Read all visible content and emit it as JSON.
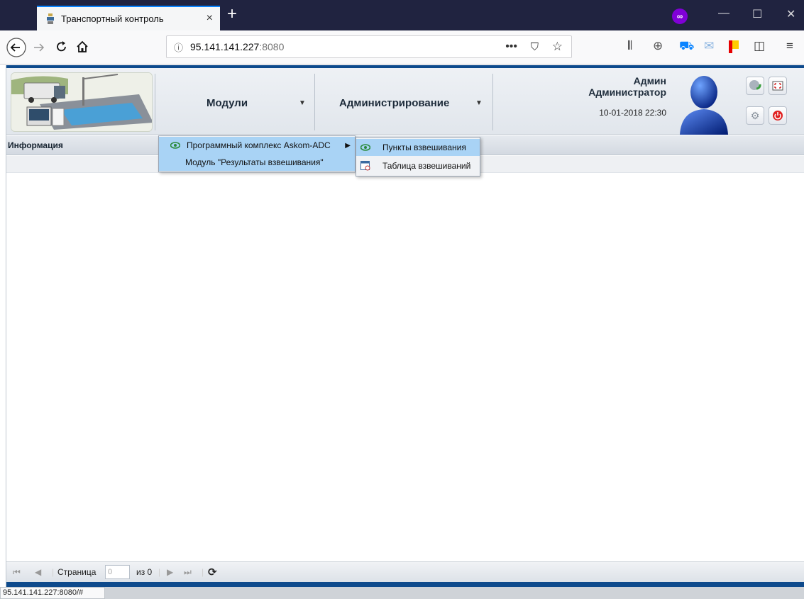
{
  "browser": {
    "tab_title": "Транспортный контроль",
    "close_symbol": "×",
    "new_tab_symbol": "+",
    "url_host": "95.141.141.227",
    "url_port": ":8080",
    "status_url": "95.141.141.227:8080/#"
  },
  "header": {
    "menu_modules": "Модули",
    "menu_admin": "Администрирование",
    "user_name": "Админ",
    "user_role": "Администратор",
    "datetime": "10-01-2018 22:30"
  },
  "info": {
    "label": "Информация"
  },
  "modules_menu": {
    "items": [
      {
        "label": "Программный комплекс Askom-ADC"
      },
      {
        "label": "Модуль \"Результаты взвешивания\""
      }
    ]
  },
  "submenu": {
    "items": [
      {
        "label": "Пункты взвешивания"
      },
      {
        "label": "Таблица взвешиваний"
      }
    ]
  },
  "pager": {
    "page_label": "Страница",
    "page_value": "0",
    "of_label": "из 0"
  },
  "colors": {
    "accent": "#0e4a8c",
    "menu_highlight": "#a9d3f5",
    "tabbar": "#202340"
  }
}
